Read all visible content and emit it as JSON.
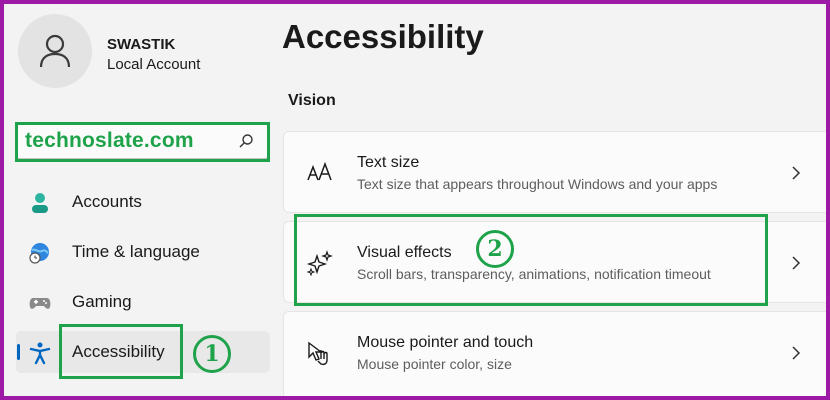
{
  "user": {
    "name": "SWASTIK",
    "account_type": "Local Account"
  },
  "search": {
    "value": "technoslate.com"
  },
  "sidebar": {
    "items": [
      {
        "label": "Accounts"
      },
      {
        "label": "Time & language"
      },
      {
        "label": "Gaming"
      },
      {
        "label": "Accessibility"
      }
    ]
  },
  "main": {
    "title": "Accessibility",
    "section": "Vision",
    "cards": [
      {
        "title": "Text size",
        "description": "Text size that appears throughout Windows and your apps"
      },
      {
        "title": "Visual effects",
        "description": "Scroll bars, transparency, animations, notification timeout"
      },
      {
        "title": "Mouse pointer and touch",
        "description": "Mouse pointer color, size"
      }
    ]
  },
  "annotations": {
    "step1": "1",
    "step2": "2"
  },
  "colors": {
    "annotation": "#1fa34a",
    "accent": "#0067c0",
    "frame": "#9c1aa6"
  }
}
